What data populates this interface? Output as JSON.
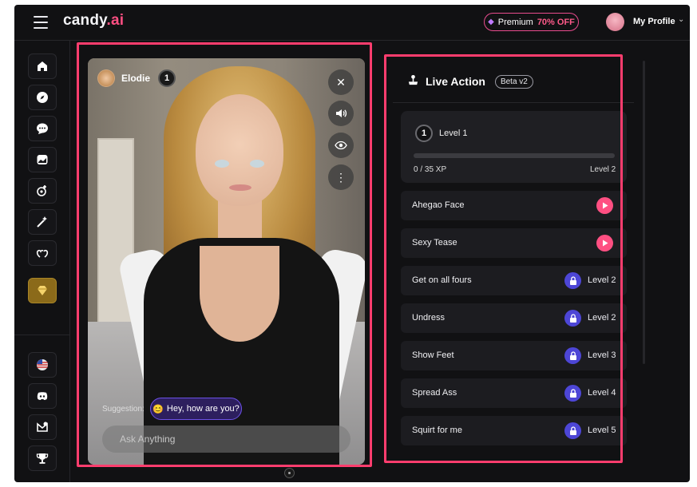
{
  "header": {
    "logo_main": "candy",
    "logo_suffix": ".ai",
    "premium_label": "Premium",
    "premium_offer": "70% OFF",
    "profile_label": "My Profile"
  },
  "sidebar": {
    "items": [
      {
        "name": "home",
        "icon": "home-icon"
      },
      {
        "name": "explore",
        "icon": "compass-icon"
      },
      {
        "name": "chat",
        "icon": "chat-bubble-icon"
      },
      {
        "name": "gallery",
        "icon": "image-icon"
      },
      {
        "name": "create",
        "icon": "create-character-icon"
      },
      {
        "name": "generate",
        "icon": "magic-wand-icon"
      },
      {
        "name": "my-ai",
        "icon": "hearts-icon"
      },
      {
        "name": "premium",
        "icon": "diamond-icon"
      }
    ],
    "bottom_items": [
      {
        "name": "language",
        "icon": "us-flag-icon"
      },
      {
        "name": "discord",
        "icon": "discord-icon"
      },
      {
        "name": "affiliate",
        "icon": "support-icon"
      },
      {
        "name": "leaderboard",
        "icon": "trophy-icon"
      }
    ]
  },
  "video": {
    "character_name": "Elodie",
    "level": "1",
    "controls": [
      "close-icon",
      "volume-icon",
      "eye-icon",
      "more-vertical-icon"
    ],
    "suggestion_label": "Suggestion:",
    "suggestion_emoji": "😊",
    "suggestion_text": "Hey, how are you?",
    "input_placeholder": "Ask Anything"
  },
  "live_action": {
    "title": "Live Action",
    "badge": "Beta v2",
    "level_card": {
      "level_number": "1",
      "level_label": "Level 1",
      "xp": "0 / 35 XP",
      "xp_fraction": 0,
      "next_level": "Level 2"
    },
    "actions": [
      {
        "label": "Ahegao Face",
        "locked": false,
        "requirement": ""
      },
      {
        "label": "Sexy Tease",
        "locked": false,
        "requirement": ""
      },
      {
        "label": "Get on all fours",
        "locked": true,
        "requirement": "Level 2"
      },
      {
        "label": "Undress",
        "locked": true,
        "requirement": "Level 2"
      },
      {
        "label": "Show Feet",
        "locked": true,
        "requirement": "Level 3"
      },
      {
        "label": "Spread Ass",
        "locked": true,
        "requirement": "Level 4"
      },
      {
        "label": "Squirt for me",
        "locked": true,
        "requirement": "Level 5"
      }
    ]
  },
  "colors": {
    "accent": "#ff4f82",
    "lock": "#4d46d6",
    "highlight": "#ff3d6e",
    "background": "#111113"
  }
}
